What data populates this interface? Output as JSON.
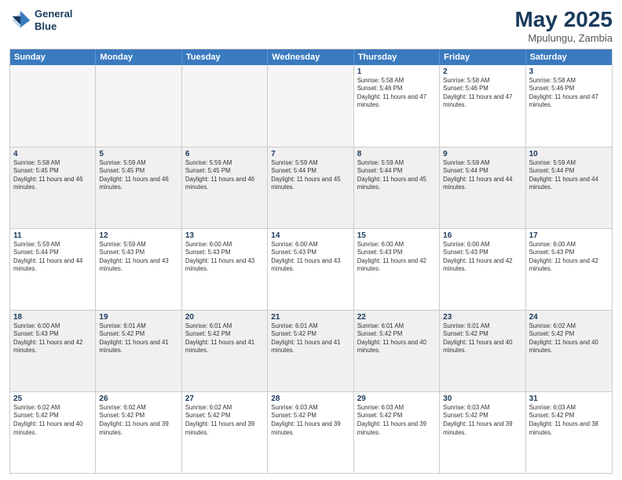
{
  "logo": {
    "line1": "General",
    "line2": "Blue"
  },
  "title": {
    "month_year": "May 2025",
    "location": "Mpulungu, Zambia"
  },
  "days_of_week": [
    "Sunday",
    "Monday",
    "Tuesday",
    "Wednesday",
    "Thursday",
    "Friday",
    "Saturday"
  ],
  "weeks": [
    [
      {
        "day": "",
        "empty": true
      },
      {
        "day": "",
        "empty": true
      },
      {
        "day": "",
        "empty": true
      },
      {
        "day": "",
        "empty": true
      },
      {
        "day": "1",
        "sunrise": "5:58 AM",
        "sunset": "5:46 PM",
        "daylight": "11 hours and 47 minutes."
      },
      {
        "day": "2",
        "sunrise": "5:58 AM",
        "sunset": "5:46 PM",
        "daylight": "11 hours and 47 minutes."
      },
      {
        "day": "3",
        "sunrise": "5:58 AM",
        "sunset": "5:46 PM",
        "daylight": "11 hours and 47 minutes."
      }
    ],
    [
      {
        "day": "4",
        "sunrise": "5:58 AM",
        "sunset": "5:45 PM",
        "daylight": "11 hours and 46 minutes.",
        "shaded": true
      },
      {
        "day": "5",
        "sunrise": "5:59 AM",
        "sunset": "5:45 PM",
        "daylight": "11 hours and 46 minutes.",
        "shaded": true
      },
      {
        "day": "6",
        "sunrise": "5:59 AM",
        "sunset": "5:45 PM",
        "daylight": "11 hours and 46 minutes.",
        "shaded": true
      },
      {
        "day": "7",
        "sunrise": "5:59 AM",
        "sunset": "5:44 PM",
        "daylight": "11 hours and 45 minutes.",
        "shaded": true
      },
      {
        "day": "8",
        "sunrise": "5:59 AM",
        "sunset": "5:44 PM",
        "daylight": "11 hours and 45 minutes.",
        "shaded": true
      },
      {
        "day": "9",
        "sunrise": "5:59 AM",
        "sunset": "5:44 PM",
        "daylight": "11 hours and 44 minutes.",
        "shaded": true
      },
      {
        "day": "10",
        "sunrise": "5:59 AM",
        "sunset": "5:44 PM",
        "daylight": "11 hours and 44 minutes.",
        "shaded": true
      }
    ],
    [
      {
        "day": "11",
        "sunrise": "5:59 AM",
        "sunset": "5:44 PM",
        "daylight": "11 hours and 44 minutes."
      },
      {
        "day": "12",
        "sunrise": "5:59 AM",
        "sunset": "5:43 PM",
        "daylight": "11 hours and 43 minutes."
      },
      {
        "day": "13",
        "sunrise": "6:00 AM",
        "sunset": "5:43 PM",
        "daylight": "11 hours and 43 minutes."
      },
      {
        "day": "14",
        "sunrise": "6:00 AM",
        "sunset": "5:43 PM",
        "daylight": "11 hours and 43 minutes."
      },
      {
        "day": "15",
        "sunrise": "6:00 AM",
        "sunset": "5:43 PM",
        "daylight": "11 hours and 42 minutes."
      },
      {
        "day": "16",
        "sunrise": "6:00 AM",
        "sunset": "5:43 PM",
        "daylight": "11 hours and 42 minutes."
      },
      {
        "day": "17",
        "sunrise": "6:00 AM",
        "sunset": "5:43 PM",
        "daylight": "11 hours and 42 minutes."
      }
    ],
    [
      {
        "day": "18",
        "sunrise": "6:00 AM",
        "sunset": "5:43 PM",
        "daylight": "11 hours and 42 minutes.",
        "shaded": true
      },
      {
        "day": "19",
        "sunrise": "6:01 AM",
        "sunset": "5:42 PM",
        "daylight": "11 hours and 41 minutes.",
        "shaded": true
      },
      {
        "day": "20",
        "sunrise": "6:01 AM",
        "sunset": "5:42 PM",
        "daylight": "11 hours and 41 minutes.",
        "shaded": true
      },
      {
        "day": "21",
        "sunrise": "6:01 AM",
        "sunset": "5:42 PM",
        "daylight": "11 hours and 41 minutes.",
        "shaded": true
      },
      {
        "day": "22",
        "sunrise": "6:01 AM",
        "sunset": "5:42 PM",
        "daylight": "11 hours and 40 minutes.",
        "shaded": true
      },
      {
        "day": "23",
        "sunrise": "6:01 AM",
        "sunset": "5:42 PM",
        "daylight": "11 hours and 40 minutes.",
        "shaded": true
      },
      {
        "day": "24",
        "sunrise": "6:02 AM",
        "sunset": "5:42 PM",
        "daylight": "11 hours and 40 minutes.",
        "shaded": true
      }
    ],
    [
      {
        "day": "25",
        "sunrise": "6:02 AM",
        "sunset": "5:42 PM",
        "daylight": "11 hours and 40 minutes."
      },
      {
        "day": "26",
        "sunrise": "6:02 AM",
        "sunset": "5:42 PM",
        "daylight": "11 hours and 39 minutes."
      },
      {
        "day": "27",
        "sunrise": "6:02 AM",
        "sunset": "5:42 PM",
        "daylight": "11 hours and 39 minutes."
      },
      {
        "day": "28",
        "sunrise": "6:03 AM",
        "sunset": "5:42 PM",
        "daylight": "11 hours and 39 minutes."
      },
      {
        "day": "29",
        "sunrise": "6:03 AM",
        "sunset": "5:42 PM",
        "daylight": "11 hours and 39 minutes."
      },
      {
        "day": "30",
        "sunrise": "6:03 AM",
        "sunset": "5:42 PM",
        "daylight": "11 hours and 39 minutes."
      },
      {
        "day": "31",
        "sunrise": "6:03 AM",
        "sunset": "5:42 PM",
        "daylight": "11 hours and 38 minutes."
      }
    ]
  ],
  "cell_labels": {
    "sunrise_prefix": "Sunrise: ",
    "sunset_prefix": "Sunset: ",
    "daylight_label": "Daylight hours"
  }
}
